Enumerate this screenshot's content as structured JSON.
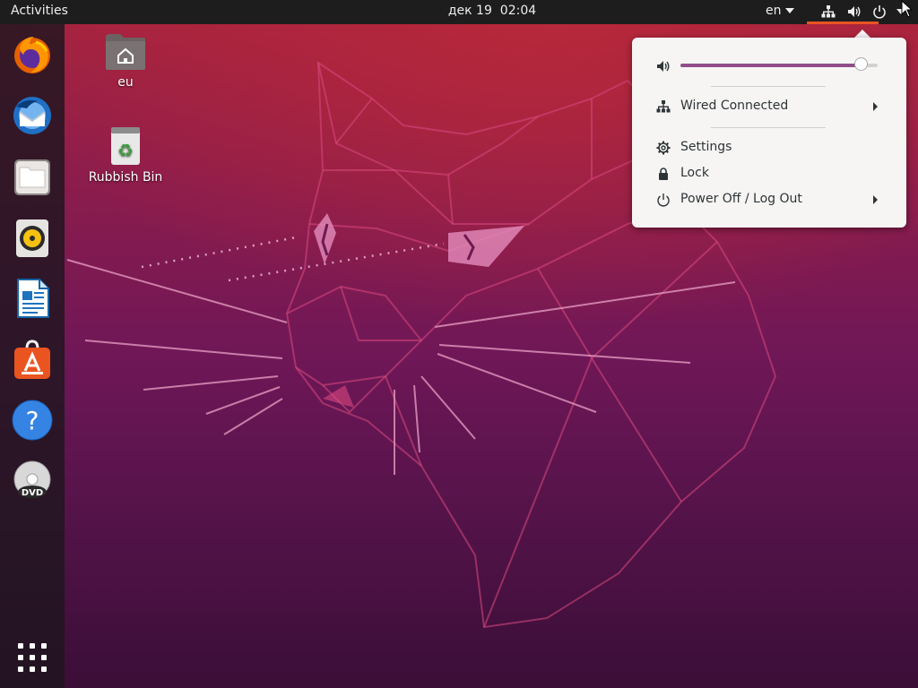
{
  "topbar": {
    "activities_label": "Activities",
    "date": "дек 19",
    "time": "02:04",
    "language": "en",
    "tray_icons": [
      "network-wired-icon",
      "speaker-volume-icon",
      "power-icon",
      "chevron-down-icon"
    ]
  },
  "dock": {
    "items": [
      {
        "name": "firefox-icon"
      },
      {
        "name": "thunderbird-icon"
      },
      {
        "name": "files-icon"
      },
      {
        "name": "rhythmbox-icon"
      },
      {
        "name": "libreoffice-writer-icon"
      },
      {
        "name": "ubuntu-software-icon"
      },
      {
        "name": "help-icon"
      },
      {
        "name": "dvd-icon"
      }
    ],
    "app_grid_icon": "app-grid-icon"
  },
  "desktop": {
    "icons": [
      {
        "label": "eu",
        "icon": "home-folder-icon"
      },
      {
        "label": "Rubbish Bin",
        "icon": "rubbish-bin-icon"
      }
    ]
  },
  "system_menu": {
    "volume": {
      "level": 0.95
    },
    "network": {
      "label": "Wired Connected"
    },
    "settings": {
      "label": "Settings"
    },
    "lock": {
      "label": "Lock"
    },
    "power": {
      "label": "Power Off / Log Out"
    }
  },
  "colors": {
    "accent": "#e95420",
    "slider": "#924d8b",
    "menu_bg": "#f6f5f4",
    "topbar_bg": "#1d1d1d"
  }
}
